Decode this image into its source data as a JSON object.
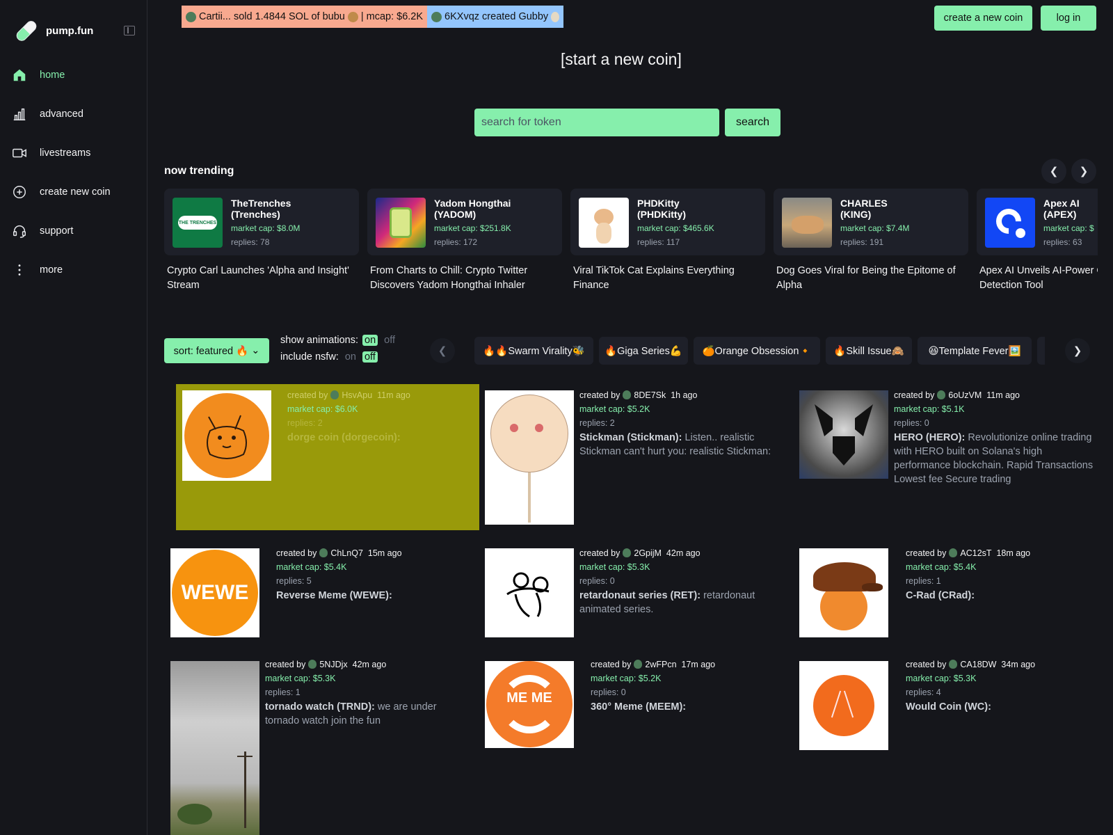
{
  "brand": {
    "name": "pump.fun"
  },
  "nav": [
    {
      "label": "home",
      "icon": "home-icon"
    },
    {
      "label": "advanced",
      "icon": "chart-icon"
    },
    {
      "label": "livestreams",
      "icon": "video-icon"
    },
    {
      "label": "create new coin",
      "icon": "plus-circle-icon"
    },
    {
      "label": "support",
      "icon": "headset-icon"
    },
    {
      "label": "more",
      "icon": "dots-vertical-icon"
    }
  ],
  "ticker": {
    "sell": "Cartii... sold 1.4844 SOL of bubu",
    "sell_mcap": "| mcap: $6.2K",
    "create": "6KXvqz created Gubby"
  },
  "header": {
    "create_label": "create a new coin",
    "login_label": "log in"
  },
  "start_link": "[start a new coin]",
  "search": {
    "placeholder": "search for token",
    "button": "search"
  },
  "trending": {
    "title": "now trending",
    "items": [
      {
        "name": "TheTrenches",
        "ticker": "(Trenches)",
        "cap": "market cap: $8.0M",
        "replies": "replies: 78",
        "headline": "Crypto Carl Launches 'Alpha and Insight' Stream",
        "img_label": "THE TRENCHES"
      },
      {
        "name": "Yadom Hongthai",
        "ticker": "(YADOM)",
        "cap": "market cap: $251.8K",
        "replies": "replies: 172",
        "headline": "From Charts to Chill: Crypto Twitter Discovers Yadom Hongthai Inhaler"
      },
      {
        "name": "PHDKitty",
        "ticker": "(PHDKitty)",
        "cap": "market cap: $465.6K",
        "replies": "replies: 117",
        "headline": "Viral TikTok Cat Explains Everything Finance"
      },
      {
        "name": "CHARLES",
        "ticker": "(KING)",
        "cap": "market cap: $7.4M",
        "replies": "replies: 191",
        "headline": "Dog Goes Viral for Being the Epitome of Alpha"
      },
      {
        "name": "Apex AI",
        "ticker": "(APEX)",
        "cap": "market cap: $",
        "replies": "replies: 63",
        "headline": "Apex AI Unveils AI-Power Cancer Detection Tool"
      }
    ]
  },
  "filters": {
    "sort": "sort: featured 🔥",
    "animations_label": "show animations:",
    "nsfw_label": "include nsfw:",
    "on": "on",
    "off": "off",
    "tags": [
      "🔥🔥Swarm Virality🐝",
      "🔥Giga Series💪",
      "🍊Orange Obsession🔸",
      "🔥Skill Issue🙈",
      "😆Template Fever🖼️"
    ]
  },
  "coins": [
    {
      "creator": "HsvApu",
      "age": "11m ago",
      "cap": "market cap: $6.0K",
      "replies": "replies: 2",
      "title": "dorge coin (dorgecoin):",
      "desc": ""
    },
    {
      "creator": "8DE7Sk",
      "age": "1h ago",
      "cap": "market cap: $5.2K",
      "replies": "replies: 2",
      "title": "Stickman (Stickman):",
      "desc": " Listen.. realistic Stickman can't hurt you: realistic Stickman:"
    },
    {
      "creator": "6oUzVM",
      "age": "11m ago",
      "cap": "market cap: $5.1K",
      "replies": "replies: 0",
      "title": "HERO (HERO):",
      "desc": " Revolutionize online trading with HERO built on Solana's high performance blockchain. Rapid Transactions Lowest fee Secure trading"
    },
    {
      "creator": "ChLnQ7",
      "age": "15m ago",
      "cap": "market cap: $5.4K",
      "replies": "replies: 5",
      "title": "Reverse Meme (WEWE):",
      "desc": "",
      "img_label": "WEWE"
    },
    {
      "creator": "2GpijM",
      "age": "42m ago",
      "cap": "market cap: $5.3K",
      "replies": "replies: 0",
      "title": "retardonaut series (RET):",
      "desc": " retardonaut animated series."
    },
    {
      "creator": "AC12sT",
      "age": "18m ago",
      "cap": "market cap: $5.4K",
      "replies": "replies: 1",
      "title": "C-Rad (CRad):",
      "desc": ""
    },
    {
      "creator": "5NJDjx",
      "age": "42m ago",
      "cap": "market cap: $5.3K",
      "replies": "replies: 1",
      "title": "tornado watch (TRND):",
      "desc": " we are under tornado watch join the fun"
    },
    {
      "creator": "2wFPcn",
      "age": "17m ago",
      "cap": "market cap: $5.2K",
      "replies": "replies: 0",
      "title": "360° Meme (MEEM):",
      "desc": "",
      "img_label": "ME ME"
    },
    {
      "creator": "CA18DW",
      "age": "34m ago",
      "cap": "market cap: $5.3K",
      "replies": "replies: 4",
      "title": "Would Coin (WC):",
      "desc": ""
    }
  ],
  "created_by_label": "created by",
  "colors": {
    "accent": "#86efac",
    "background": "#15161b",
    "card": "#1e2029",
    "featured": "#999a0a"
  }
}
